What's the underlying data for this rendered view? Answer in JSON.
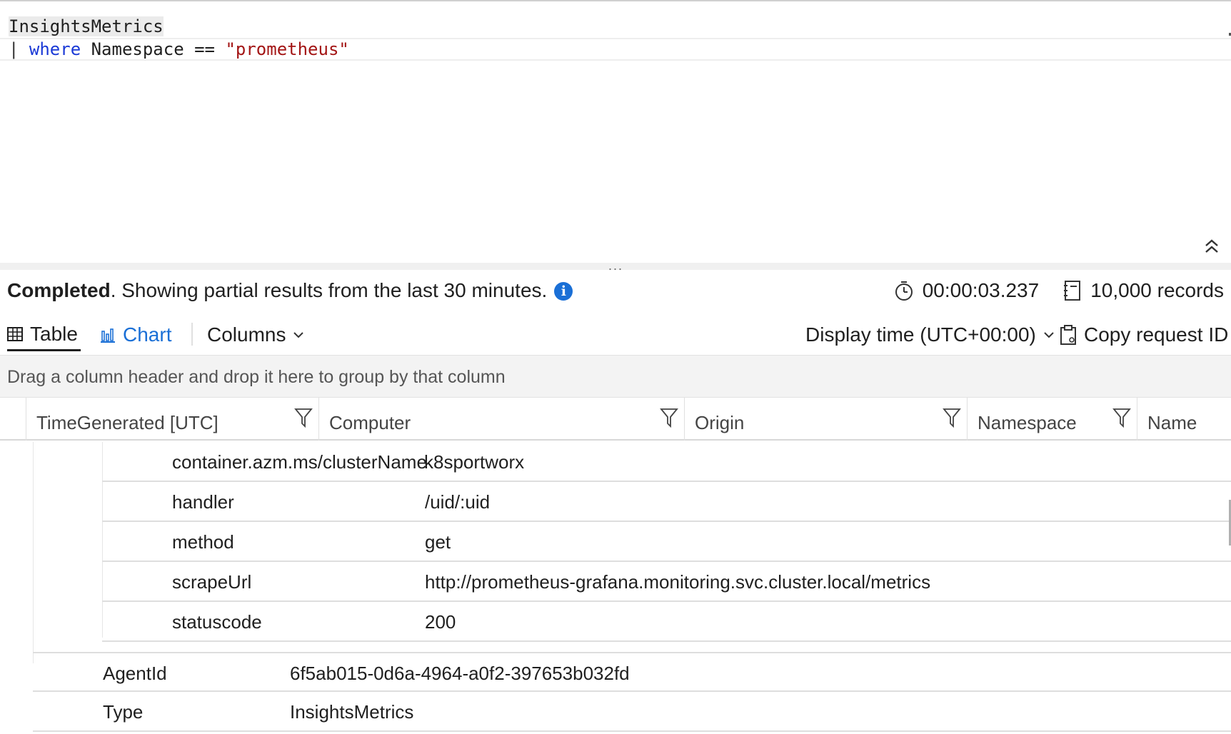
{
  "editor": {
    "line1": {
      "table": "InsightsMetrics"
    },
    "line2": {
      "pipe": "| ",
      "keyword": "where",
      "field": " Namespace == ",
      "string": "\"prometheus\""
    }
  },
  "splitter": {
    "dots": "..."
  },
  "status": {
    "state": "Completed",
    "message": ". Showing partial results from the last 30 minutes.",
    "duration": "00:00:03.237",
    "records": "10,000 records"
  },
  "toolbar": {
    "table_label": "Table",
    "chart_label": "Chart",
    "columns_label": "Columns",
    "display_time_label": "Display time (UTC+00:00)",
    "copy_request_label": "Copy request ID"
  },
  "group_panel": {
    "hint": "Drag a column header and drop it here to group by that column"
  },
  "columns": [
    {
      "label": "TimeGenerated [UTC]"
    },
    {
      "label": "Computer"
    },
    {
      "label": "Origin"
    },
    {
      "label": "Namespace"
    },
    {
      "label": "Name"
    }
  ],
  "tags": [
    {
      "key": "container.azm.ms/clusterName",
      "value": "k8sportworx"
    },
    {
      "key": "handler",
      "value": "/uid/:uid"
    },
    {
      "key": "method",
      "value": "get"
    },
    {
      "key": "scrapeUrl",
      "value": "http://prometheus-grafana.monitoring.svc.cluster.local/metrics"
    },
    {
      "key": "statuscode",
      "value": "200"
    }
  ],
  "properties": [
    {
      "key": "AgentId",
      "value": "6f5ab015-0d6a-4964-a0f2-397653b032fd"
    },
    {
      "key": "Type",
      "value": "InsightsMetrics"
    }
  ],
  "colors": {
    "accent": "#1a6fd6",
    "keyword": "#1a39d6",
    "string": "#a31515"
  },
  "icons": [
    "info-icon",
    "stopwatch-icon",
    "records-icon",
    "table-icon",
    "chart-icon",
    "chevron-down-icon",
    "clipboard-icon",
    "filter-icon",
    "collapse-up-icon"
  ]
}
